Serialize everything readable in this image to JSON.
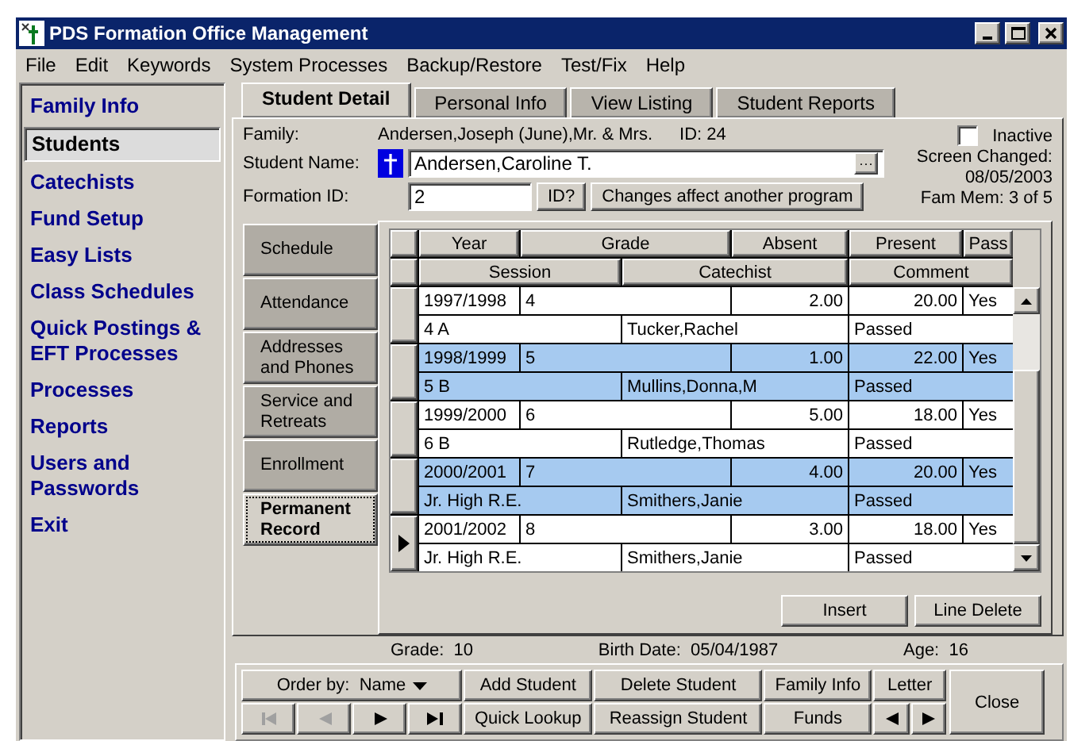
{
  "window": {
    "title": "PDS Formation Office Management"
  },
  "menu": [
    "File",
    "Edit",
    "Keywords",
    "System Processes",
    "Backup/Restore",
    "Test/Fix",
    "Help"
  ],
  "sidebar": [
    {
      "label": "Family Info",
      "selected": false
    },
    {
      "label": "Students",
      "selected": true
    },
    {
      "label": "Catechists",
      "selected": false
    },
    {
      "label": "Fund Setup",
      "selected": false
    },
    {
      "label": "Easy Lists",
      "selected": false
    },
    {
      "label": "Class Schedules",
      "selected": false
    },
    {
      "label": "Quick Postings & EFT Processes",
      "selected": false
    },
    {
      "label": "Processes",
      "selected": false
    },
    {
      "label": "Reports",
      "selected": false
    },
    {
      "label": "Users and Passwords",
      "selected": false
    },
    {
      "label": "Exit",
      "selected": false
    }
  ],
  "tabs": [
    {
      "label": "Student Detail",
      "selected": true
    },
    {
      "label": "Personal Info",
      "selected": false
    },
    {
      "label": "View Listing",
      "selected": false
    },
    {
      "label": "Student Reports",
      "selected": false
    }
  ],
  "family": {
    "label": "Family:",
    "value": "Andersen,Joseph (June),Mr. & Mrs.",
    "id": "ID: 24"
  },
  "student_name": {
    "label": "Student Name:",
    "value": "Andersen,Caroline T.",
    "browse": "···"
  },
  "formation_id": {
    "label": "Formation ID:",
    "value": "2",
    "id_button": "ID?",
    "notice_button": "Changes affect another program"
  },
  "inactive": {
    "label": "Inactive",
    "checked": false
  },
  "screen_changed": {
    "label": "Screen Changed:",
    "date": "08/05/2003"
  },
  "fam_mem": "Fam Mem: 3 of 5",
  "side_tabs": [
    {
      "label": "Schedule",
      "selected": false
    },
    {
      "label": "Attendance",
      "selected": false
    },
    {
      "label": "Addresses and Phones",
      "selected": false
    },
    {
      "label": "Service and Retreats",
      "selected": false
    },
    {
      "label": "Enrollment",
      "selected": false
    },
    {
      "label": "Permanent Record",
      "selected": true
    }
  ],
  "table": {
    "columns_top": [
      "Year",
      "Grade",
      "Absent",
      "Present",
      "Pass"
    ],
    "columns_bottom": [
      "Session",
      "Catechist",
      "Comment"
    ],
    "rows": [
      {
        "year": "1997/1998",
        "grade": "4",
        "absent": "2.00",
        "present": "20.00",
        "pass": "Yes",
        "session": "4 A",
        "catechist": "Tucker,Rachel",
        "comment": "Passed",
        "current": false
      },
      {
        "year": "1998/1999",
        "grade": "5",
        "absent": "1.00",
        "present": "22.00",
        "pass": "Yes",
        "session": "5 B",
        "catechist": "Mullins,Donna,M",
        "comment": "Passed",
        "current": false
      },
      {
        "year": "1999/2000",
        "grade": "6",
        "absent": "5.00",
        "present": "18.00",
        "pass": "Yes",
        "session": "6 B",
        "catechist": "Rutledge,Thomas",
        "comment": "Passed",
        "current": false
      },
      {
        "year": "2000/2001",
        "grade": "7",
        "absent": "4.00",
        "present": "20.00",
        "pass": "Yes",
        "session": "Jr. High R.E.",
        "catechist": "Smithers,Janie",
        "comment": "Passed",
        "current": false
      },
      {
        "year": "2001/2002",
        "grade": "8",
        "absent": "3.00",
        "present": "18.00",
        "pass": "Yes",
        "session": "Jr. High R.E.",
        "catechist": "Smithers,Janie",
        "comment": "Passed",
        "current": true
      }
    ]
  },
  "table_buttons": [
    "Insert",
    "Line Delete"
  ],
  "summary": [
    {
      "label": "Grade:",
      "value": "10"
    },
    {
      "label": "Birth Date:",
      "value": "05/04/1987"
    },
    {
      "label": "Age:",
      "value": "16"
    }
  ],
  "toolbar": {
    "order_by": {
      "label": "Order by:",
      "value": "Name"
    },
    "nav": [
      {
        "kind": "first",
        "disabled": true
      },
      {
        "kind": "prev",
        "disabled": true
      },
      {
        "kind": "next",
        "disabled": false
      },
      {
        "kind": "last",
        "disabled": false
      }
    ],
    "buttons_top": [
      "Add Student",
      "Delete Student",
      "Family Info",
      "Letter"
    ],
    "buttons_bottom": [
      "Quick Lookup",
      "Reassign Student",
      "Funds"
    ],
    "close": "Close"
  }
}
